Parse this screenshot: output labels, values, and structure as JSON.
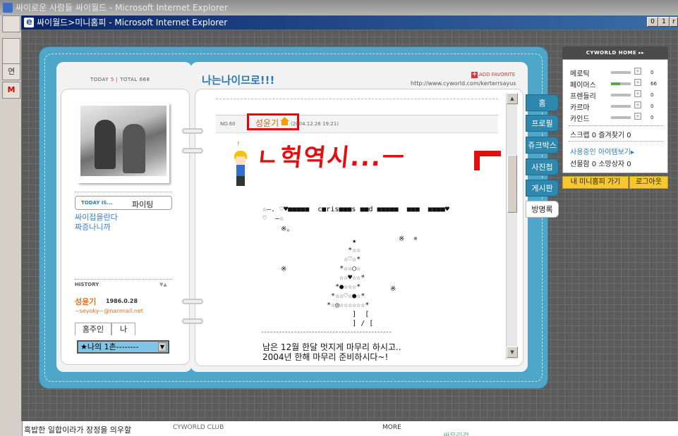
{
  "back_window": {
    "title": "싸이로운 사람들 싸이월드 - Microsoft Internet Explorer",
    "left_buttons": [
      "",
      "",
      "연",
      "M"
    ],
    "bottom_text": "흑밥한 일합이라가 장정을 의우할",
    "bottom_label": "CYWORLD CLUB",
    "bottom_more": "MORE",
    "bottom_right": "싸우리걱"
  },
  "window": {
    "title": "싸이월드>미니홈피 - Microsoft Internet Explorer",
    "controls": [
      "0",
      "1",
      "r"
    ]
  },
  "header": {
    "today_label": "TODAY",
    "today_count": "5",
    "total_label": "TOTAL",
    "total_count": "668",
    "minihompy_title": "나는나이므로!!!",
    "add_favorite": "ADD FAVORITE",
    "url": "http://www.cyworld.com/kerterrsayus"
  },
  "profile": {
    "today_is_label": "TODAY IS...",
    "mood": "파이팅",
    "intro_line1": "싸이접을란다",
    "intro_line2": "짜증나니까",
    "history_label": "HISTORY",
    "history_arrows": "▼▲",
    "owner_name": "성윤기",
    "owner_birth": "1986.0.28",
    "email": "~seyoky~@nanmail.net",
    "tabs": [
      "홈주인",
      "나"
    ],
    "ilchon_select": "★나의 1촌--------",
    "ilchon_arrow": "▼"
  },
  "post": {
    "number": "NO.60",
    "author": "성윤기",
    "date": "(2004.12.26 19:21)",
    "handwriting": "ㄴ헉역시...ㅡ",
    "art_line1": "☆―. ♡♥■■■■■  c■ris■■■s ■■d ■■■■■  ■■■  ■■■■♥",
    "art_line2": "♡  ―☆",
    "art_line3": "※。",
    "tree": "        ★\n       *☆☆\n      ☆♡☆*\n     *☆☆○☆\n     ☆☆♥☆☆*\n    *●☆☆☆*\n   *☆☆♡☆●☆*\n  *☆◎☆☆☆☆☆☆*\n        ]  [\n        ] / [",
    "decor_marks": [
      "※",
      "※",
      "※",
      "※"
    ],
    "squiggle": "^^^^^^^^^^^^^^^^^^^^^^^^^^^^^^^^^^^^^^^^^^^^",
    "message_line1": "남은 12월 한달 멋지게 마무리 하시고..",
    "message_line2": "2004년 한해 마무리 준비하시다~!"
  },
  "scroll": {
    "up": "▲",
    "down": "▼"
  },
  "side_tabs": [
    "홈",
    "프로필",
    "쥬크박스",
    "사진첩",
    "게시판",
    "방명록"
  ],
  "cyworld_home": {
    "header": "CYWORLD HOME ▸▸",
    "stats": [
      {
        "label": "메로틱",
        "value": "0",
        "level": 0
      },
      {
        "label": "페이머스",
        "value": "66",
        "level": 0.45
      },
      {
        "label": "프렌들리",
        "value": "0",
        "level": 0
      },
      {
        "label": "카르마",
        "value": "0",
        "level": 0
      },
      {
        "label": "카인드",
        "value": "0",
        "level": 0
      }
    ],
    "stat_button": "-",
    "scrap": "스크랩 0 즐겨찾기 0",
    "items_link": "사용중인 아이템보기▸",
    "gift": "선물함 0 소망상자 0",
    "go_my_button": "내 미니홈피 가기",
    "logout_button": "로그아웃"
  }
}
